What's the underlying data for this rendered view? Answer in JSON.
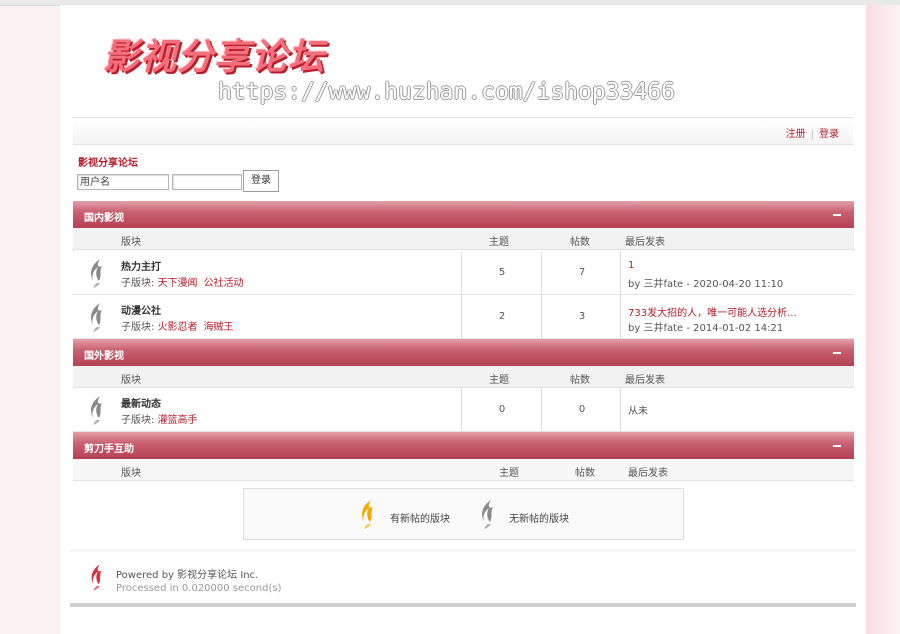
{
  "site": {
    "logo_text": "影视分享论坛",
    "watermark": "https://www.huzhan.com/ishop33466"
  },
  "userbar": {
    "register": "注册",
    "login": "登录"
  },
  "breadcrumb": "影视分享论坛",
  "login_form": {
    "username_placeholder": "用户名",
    "password_value": "",
    "button": "登录"
  },
  "columns": {
    "forum": "版块",
    "threads": "主题",
    "posts": "帖数",
    "last_post": "最后发表"
  },
  "categories": [
    {
      "name": "国内影视",
      "toggle": "—",
      "forums": [
        {
          "name": "热力主打",
          "subs_label": "子版块:",
          "subs": [
            "天下漫闻",
            "公社活动"
          ],
          "threads": "5",
          "posts": "7",
          "last_title": "1",
          "last_by": "by 三井fate - 2020-04-20 11:10"
        },
        {
          "name": "动漫公社",
          "subs_label": "子版块:",
          "subs": [
            "火影忍者",
            "海贼王"
          ],
          "threads": "2",
          "posts": "3",
          "last_title": "733发大招的人，唯一可能人选分析...",
          "last_by": "by 三井fate - 2014-01-02 14:21"
        }
      ]
    },
    {
      "name": "国外影视",
      "toggle": "—",
      "forums": [
        {
          "name": "最新动态",
          "subs_label": "子版块:",
          "subs": [
            "灌篮高手"
          ],
          "threads": "0",
          "posts": "0",
          "last_none": "从未"
        }
      ]
    },
    {
      "name": "剪刀手互助",
      "toggle": "—",
      "forums": []
    }
  ],
  "legend": {
    "new": "有新帖的版块",
    "none": "无新帖的版块"
  },
  "footer": {
    "powered": "Powered by 影视分享论坛 Inc.",
    "processed": "Processed in 0.020000 second(s)"
  },
  "colors": {
    "accent": "#b21e2d",
    "category_bar": "#c96272",
    "icon_gray": "#8a8a8a",
    "icon_new": "#f2a900"
  },
  "icons": {
    "forum_row": "flame-icon-gray",
    "legend_new": "flame-icon-yellow",
    "legend_none": "flame-icon-gray",
    "footer": "flame-icon-red"
  }
}
